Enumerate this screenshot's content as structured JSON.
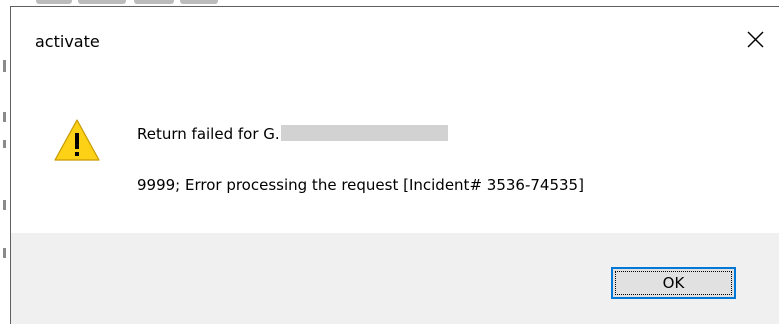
{
  "dialog": {
    "title": "activate",
    "close_icon": "close-icon",
    "warning_icon": "warning-icon",
    "message_line1_prefix": "Return failed for G.",
    "message_line2": "9999; Error processing the request [Incident# 3536-74535]",
    "ok_label": "OK"
  },
  "colors": {
    "warning_fill": "#fcd116",
    "button_focus_border": "#0078d7",
    "footer_background": "#f0f0f0"
  }
}
